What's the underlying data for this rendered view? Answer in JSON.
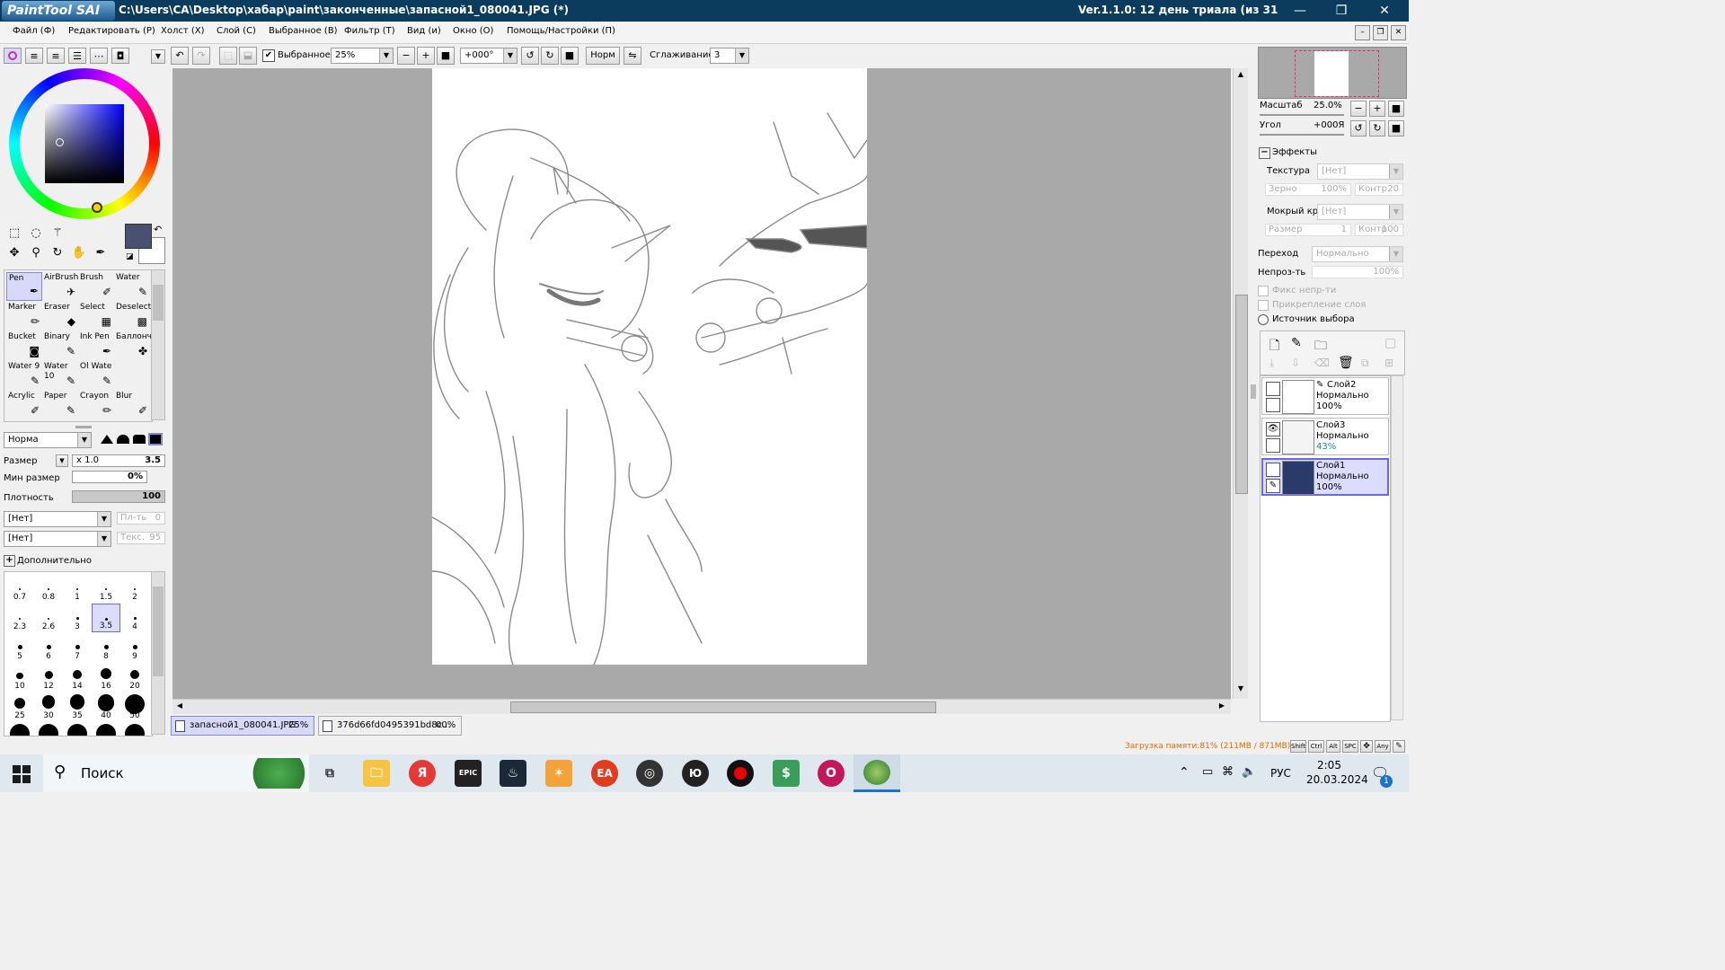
{
  "titlebar": {
    "app_logo": "PaintTool SAI",
    "path": "C:\\Users\\CA\\Desktop\\хабар\\paint\\законченные\\запасной1_080041.JPG (*)",
    "version": "Ver.1.1.0: 12 день триала (из 31",
    "minimize": "—",
    "maximize": "❐",
    "close": "✕"
  },
  "menu": {
    "items": [
      "Файл (Ф)",
      "Редактировать (Р)",
      "Холст (Х)",
      "Слой (С)",
      "Выбранное (В)",
      "Фильтр (Т)",
      "Вид (и)",
      "Окно (О)",
      "Помощь/Настройки (П)"
    ]
  },
  "toolbar": {
    "selection_checkbox_label": "Выбранное",
    "zoom_value": "25%",
    "angle_value": "+000°",
    "norm_label": "Норм",
    "smoothing_label": "Сглаживание",
    "smoothing_value": "3"
  },
  "tools": {
    "items": [
      {
        "label": "Pen",
        "icon": "pen-icon",
        "active": true
      },
      {
        "label": "AirBrush",
        "icon": "airbrush-icon"
      },
      {
        "label": "Brush",
        "icon": "brush-icon"
      },
      {
        "label": "Water",
        "icon": "water-brush-icon"
      },
      {
        "label": "Marker",
        "icon": "marker-icon"
      },
      {
        "label": "Eraser",
        "icon": "eraser-icon"
      },
      {
        "label": "Select",
        "icon": "select-brush-icon"
      },
      {
        "label": "Deselect",
        "icon": "deselect-brush-icon"
      },
      {
        "label": "Bucket",
        "icon": "bucket-icon"
      },
      {
        "label": "Binary",
        "icon": "binary-pen-icon"
      },
      {
        "label": "Ink Pen",
        "icon": "ink-pen-icon"
      },
      {
        "label": "Баллонч",
        "icon": "spray-icon"
      },
      {
        "label": "Water 9",
        "icon": "water-brush-icon"
      },
      {
        "label": "Water 10",
        "icon": "water-brush-icon"
      },
      {
        "label": "Ol Wate",
        "icon": "oil-water-icon"
      },
      {
        "label": "",
        "icon": ""
      },
      {
        "label": "Acrylic",
        "icon": "acrylic-icon"
      },
      {
        "label": "Paper",
        "icon": "paper-icon"
      },
      {
        "label": "Crayon",
        "icon": "crayon-icon"
      },
      {
        "label": "Blur",
        "icon": "blur-icon"
      }
    ]
  },
  "brush": {
    "mode": "Норма",
    "size_label": "Размер",
    "size_multiplier": "x 1.0",
    "size_value": "3.5",
    "min_size_label": "Мин размер",
    "min_size_value": "0%",
    "density_label": "Плотность",
    "density_value": "100",
    "density_fraction": 1.0,
    "shape_1": "[Нет]",
    "shape_1_strength": "0",
    "shape_1_strength_label": "Пл-ть",
    "texture": "[Нет]",
    "texture_strength": "95",
    "texture_strength_label": "Текс.",
    "advanced_label": "Дополнительно"
  },
  "brush_sizes": [
    "0.7",
    "0.8",
    "1",
    "1.5",
    "2",
    "2.3",
    "2.6",
    "3",
    "3.5",
    "4",
    "5",
    "6",
    "7",
    "8",
    "9",
    "10",
    "12",
    "14",
    "16",
    "20",
    "25",
    "30",
    "35",
    "40",
    "50",
    "",
    "",
    "",
    "",
    ""
  ],
  "brush_sizes_selected": "3.5",
  "navigator": {
    "zoom_label": "Масштаб",
    "zoom_value": "25.0%",
    "angle_label": "Угол",
    "angle_value": "+000Я"
  },
  "effects": {
    "header": "Эффекты",
    "texture_label": "Текстура",
    "texture_value": "[Нет]",
    "grain_label": "Зерно",
    "grain_value": "100%",
    "contrast_label": "Контр",
    "contrast_value": "20",
    "wet_edge_label": "Мокрый край",
    "wet_edge_value": "[Нет]",
    "size_label": "Размер",
    "size_value": "1",
    "contrast2_label": "Контр",
    "contrast2_value": "100"
  },
  "layer_props": {
    "blend_label": "Переход",
    "blend_value": "Нормально",
    "opacity_label": "Непроз-ть",
    "opacity_value": "100%",
    "fix_opacity": "Фикс непр-ти",
    "clip_layer": "Прикрепление слоя",
    "selection_source": "Источник выбора"
  },
  "layers": [
    {
      "name": "Слой2",
      "mode": "Нормально",
      "opacity": "100%",
      "visible": false,
      "selected": false
    },
    {
      "name": "Слой3",
      "mode": "Нормально",
      "opacity": "43%",
      "visible": true,
      "selected": false
    },
    {
      "name": "Слой1",
      "mode": "Нормально",
      "opacity": "100%",
      "visible": false,
      "selected": true
    }
  ],
  "documents": [
    {
      "name": "запасной1_080041.JPG",
      "zoom": "25%",
      "active": true
    },
    {
      "name": "376d66fd0495391bd8c...",
      "zoom": "00%",
      "active": false
    }
  ],
  "status": {
    "memory": "Загрузка памяти:81% (211MB / 871MB)",
    "keys": [
      "Shift",
      "Ctrl",
      "Alt",
      "SPC",
      "Any"
    ]
  },
  "taskbar": {
    "search_placeholder": "Поиск",
    "language": "РУС",
    "time": "2:05",
    "date": "20.03.2024",
    "notification_count": "1"
  },
  "colors": {
    "title_bg": "#0b3c5d",
    "current_color": "#4a5070",
    "selection_highlight": "#dcdcff",
    "memory_text": "#e06a00",
    "canvas_bg": "#a9a9a9"
  }
}
